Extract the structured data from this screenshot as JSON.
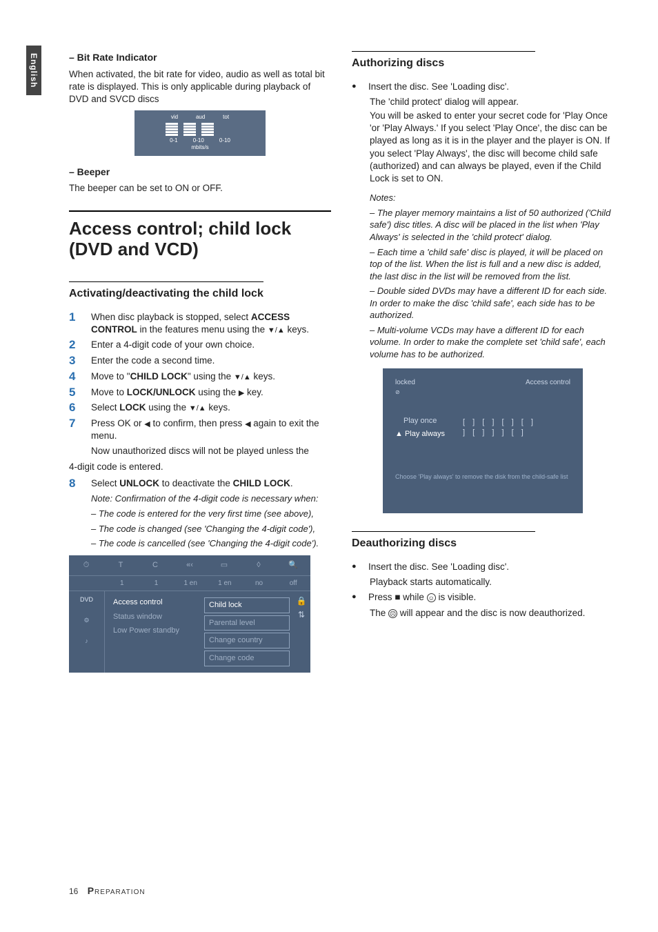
{
  "sidetab": "English",
  "left": {
    "bitrate": {
      "heading": "–   Bit Rate Indicator",
      "body": "When activated, the bit rate for video, audio as well as total bit rate is displayed. This is only applicable during playback of DVD and SVCD discs",
      "cols": [
        "vid",
        "aud",
        "tot"
      ],
      "scale": [
        "0-1",
        "0-10",
        "0-10"
      ],
      "unit": "mbits/s"
    },
    "beeper": {
      "heading": "–   Beeper",
      "body": "The beeper can be set to ON or OFF."
    },
    "section_title": "Access control; child lock (DVD and VCD)",
    "h2": "Activating/deactivating the child lock",
    "steps": [
      {
        "n": "1",
        "t_pre": "When disc playback is stopped, select ",
        "b1": "ACCESS CONTROL",
        "t_mid": " in the features menu using the ",
        "tri": "▼/▲",
        "t_post": " keys."
      },
      {
        "n": "2",
        "t_pre": "Enter a 4-digit code of your own choice."
      },
      {
        "n": "3",
        "t_pre": "Enter the code a second time."
      },
      {
        "n": "4",
        "t_pre": "Move to \"",
        "b1": "CHILD LOCK",
        "t_mid": "\" using the ",
        "tri": "▼/▲",
        "t_post": " keys."
      },
      {
        "n": "5",
        "t_pre": "Move to ",
        "b1": "LOCK/UNLOCK",
        "t_mid": " using the ",
        "tri": "▶",
        "t_post": " key."
      },
      {
        "n": "6",
        "t_pre": "Select ",
        "b1": "LOCK",
        "t_mid": " using the ",
        "tri": "▼/▲",
        "t_post": " keys."
      },
      {
        "n": "7",
        "t_pre": "Press OK or ",
        "tri": "◀",
        "t_mid": " to confirm, then press ",
        "tri2": "◀",
        "t_post": " again to exit the menu."
      },
      {
        "n": "8",
        "t_pre": "Select ",
        "b1": "UNLOCK",
        "t_mid": " to deactivate the ",
        "b2": "CHILD LOCK",
        "t_post": "."
      }
    ],
    "after7a": "Now unauthorized discs will not be played unless the",
    "after7b": "4-digit code is entered.",
    "note_lead": "Note: Confirmation of the 4-digit code is necessary when:",
    "notes": [
      "–   The code is entered for the very first time (see above),",
      "–   The code is changed (see 'Changing the 4-digit code'),",
      "–   The code is cancelled (see 'Changing the 4-digit code')."
    ],
    "menu": {
      "row2": [
        "1",
        "1",
        "1 en",
        "1 en",
        "no",
        "off"
      ],
      "left_icon_top": "DVD",
      "mid": [
        "Access control",
        "Status window",
        "Low Power standby"
      ],
      "right": [
        "Child lock",
        "Parental level",
        "Change country",
        "Change code"
      ]
    }
  },
  "right": {
    "h2a": "Authorizing discs",
    "bul1": "Insert the disc. See 'Loading disc'.",
    "sub1": "The 'child protect' dialog will appear.",
    "para1": "You will be asked to enter your secret code for 'Play Once 'or 'Play Always.' If you select 'Play Once', the disc can be played as long as it is in the player and the player is ON. If you select 'Play Always', the disc will become child safe (authorized) and can always be played, even if the Child Lock is set to ON.",
    "notes_head": "Notes:",
    "notes": [
      "–   The player memory maintains a list of 50 authorized ('Child safe') disc titles. A disc will be placed in the list when 'Play Always' is selected in the 'child protect' dialog.",
      "–   Each time a 'child safe' disc is played, it will be placed on top of the list. When the list is full and a new disc is added, the last disc in the list will be removed from the list.",
      "–   Double sided DVDs may have a different ID for each side. In order to make the disc 'child safe', each side has to be authorized.",
      "–   Multi-volume VCDs may have a different ID for each volume. In order to make the complete set 'child safe', each volume has to be authorized."
    ],
    "dialog": {
      "locked": "locked",
      "title": "Access control",
      "opt1": "Play once",
      "opt2": "Play always",
      "code1": "[ ] [ ] [ ] [ ]",
      "code2": "] [ ] ] ] [ ]",
      "foot": "Choose 'Play always' to remove the disk from the child-safe list"
    },
    "h2b": "Deauthorizing discs",
    "bul2": "Insert the disc. See 'Loading disc'.",
    "sub2": "Playback starts automatically.",
    "bul3_pre": "Press ",
    "bul3_stop": "■",
    "bul3_mid": " while ",
    "bul3_post": " is visible.",
    "sub3_pre": "The ",
    "sub3_post": " will appear and the disc is now deauthorized."
  },
  "footer": {
    "page": "16",
    "section": "PREPARATION"
  }
}
